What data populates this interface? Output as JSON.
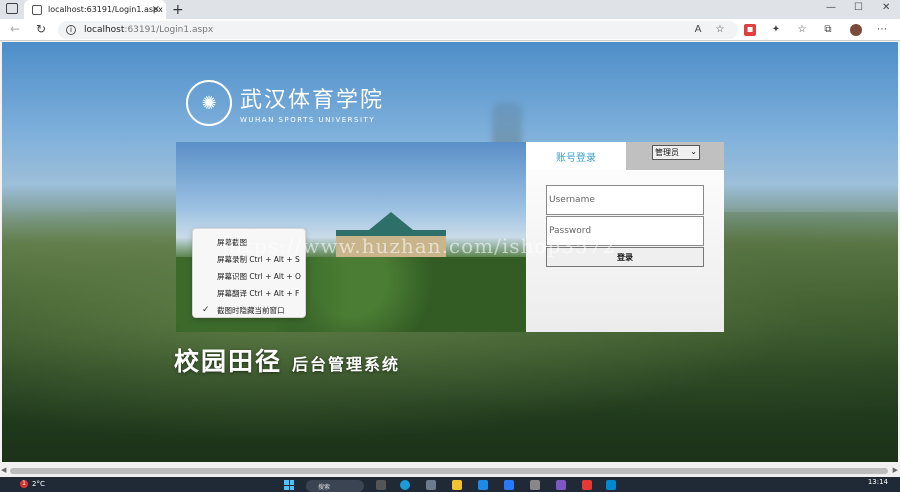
{
  "browser": {
    "tab_title": "localhost:63191/Login1.aspx",
    "new_tab": "+",
    "close_tab": "×",
    "url_host": "localhost",
    "url_path": ":63191/Login1.aspx",
    "min": "—",
    "max": "☐",
    "close": "✕"
  },
  "logo": {
    "cn": "武汉体育学院",
    "en": "WUHAN SPORTS UNIVERSITY"
  },
  "context_menu": {
    "items": [
      "屏幕截图",
      "屏幕录制 Ctrl + Alt + S",
      "屏幕识图 Ctrl + Alt + O",
      "屏幕翻译 Ctrl + Alt + F",
      "截图时隐藏当前窗口"
    ]
  },
  "login": {
    "tab_label": "账号登录",
    "role_selected": "管理员",
    "username_placeholder": "Username",
    "password_placeholder": "Password",
    "submit_label": "登录"
  },
  "system": {
    "title_big": "校园田径",
    "title_small": "后台管理系统"
  },
  "watermark": "https://www.huzhan.com/ishop3572",
  "taskbar": {
    "notif_count": "1",
    "weather": "2°C",
    "search": "搜索",
    "time": "13:14"
  }
}
